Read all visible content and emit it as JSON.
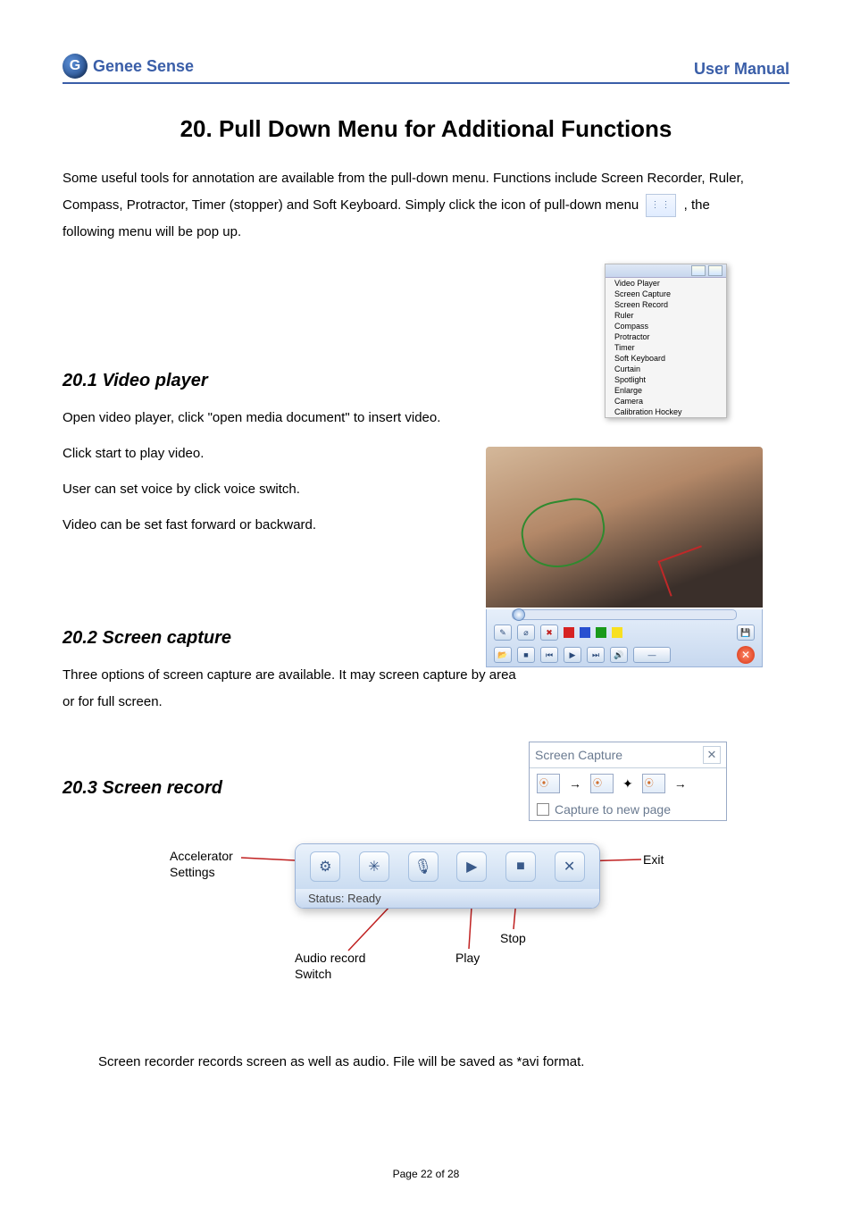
{
  "header": {
    "brand": "Genee Sense",
    "right": "User Manual"
  },
  "title": "20. Pull Down Menu for Additional Functions",
  "intro": {
    "line1a": "Some useful tools for annotation are available from the pull-down menu.  Functions include Screen Recorder, Ruler,",
    "line2a": "Compass, Protractor, Timer (stopper) and Soft Keyboard.  Simply click the icon of pull-down menu ",
    "line2b": " , the",
    "line3": "following menu will be pop up."
  },
  "dropdown": {
    "items": [
      "Video Player",
      "Screen Capture",
      "Screen Record",
      "Ruler",
      "Compass",
      "Protractor",
      "Timer",
      "Soft Keyboard",
      "Curtain",
      "Spotlight",
      "Enlarge",
      "Camera",
      "Calibration Hockey"
    ]
  },
  "section201": {
    "heading": "20.1  Video player",
    "p1": "Open video player, click \"open media document\" to insert video.",
    "p2": "Click start to play video.",
    "p3": "User can set voice by click voice switch.",
    "p4": "Video can be set fast forward or backward."
  },
  "section202": {
    "heading": "20.2  Screen capture",
    "p1": "Three options of screen capture are available.  It may screen capture by area or for full screen."
  },
  "screen_capture_fig": {
    "title": "Screen Capture",
    "footer": "Capture to new page"
  },
  "section203": {
    "heading": "20.3 Screen record",
    "labels": {
      "accelerator": "Accelerator",
      "settings": "Settings",
      "exit": "Exit",
      "audio": "Audio record",
      "switch": "Switch",
      "play": "Play",
      "stop": "Stop"
    },
    "status": "Status: Ready",
    "footer_note": "Screen recorder records screen as well as audio.  File will be saved as *avi format."
  },
  "page_footer": "Page 22 of 28"
}
